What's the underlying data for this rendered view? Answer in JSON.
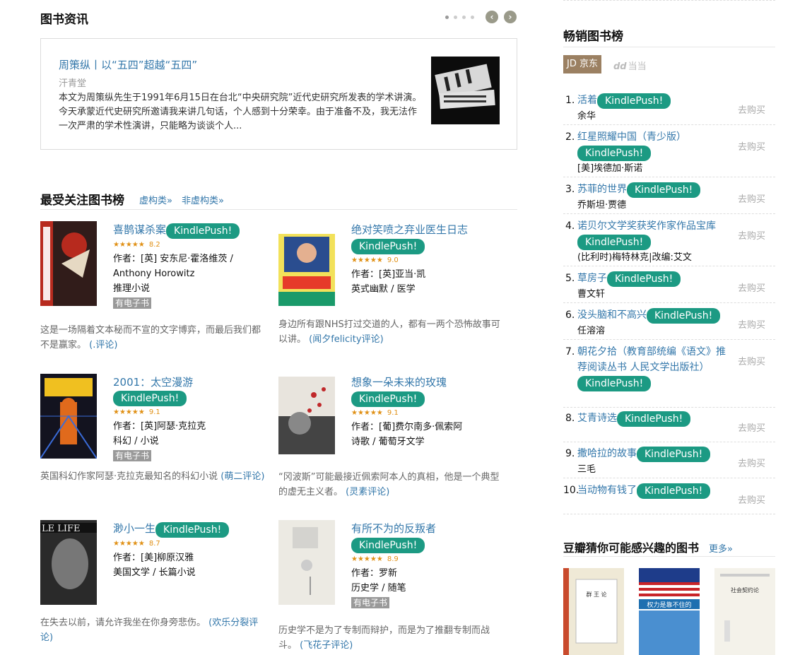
{
  "news": {
    "heading": "图书资讯",
    "prev": "‹",
    "next": "›",
    "item": {
      "title": "周策纵丨以“五四”超越“五四”",
      "author": "汗青堂",
      "desc": "本文为周策纵先生于1991年6月15日在台北“中央研究院”近代史研究所发表的学术讲演。今天承蒙近代史研究所邀请我来讲几句话，个人感到十分荣幸。由于准备不及，我无法作一次严肃的学术性演讲，只能略为谈谈个人..."
    }
  },
  "popular": {
    "heading": "最受关注图书榜",
    "tabs": [
      "虚构类»",
      "非虚构类»"
    ],
    "kindle": "KindlePush!",
    "ebook": "有电子书",
    "books": [
      {
        "title": "喜鹊谋杀案",
        "stars": "★★★★★",
        "score": "8.2",
        "lines": [
          "作者：[英] 安东尼·霍洛维茨 / Anthony Horowitz",
          "推理小说"
        ],
        "ebook": true,
        "desc": "这是一场隔着文本秘而不宣的文字博弈，而最后我们都不是赢家。",
        "review": "(.评论)",
        "cover_color": "#b72a1e"
      },
      {
        "title": "绝对笑喷之弃业医生日志",
        "stars": "★★★★★",
        "score": "9.0",
        "lines": [
          "作者：[英]亚当·凯",
          "英式幽默 / 医学"
        ],
        "ebook": false,
        "desc": "身边所有跟NHS打过交道的人，都有一两个恐怖故事可以讲。",
        "review": "(闻夕felicity评论)",
        "cover_color": "#f2e15a"
      },
      {
        "title": "2001：太空漫游",
        "stars": "★★★★★",
        "score": "9.1",
        "lines": [
          "作者：[英]阿瑟·克拉克",
          "科幻 / 小说"
        ],
        "ebook": true,
        "desc": "英国科幻作家阿瑟·克拉克最知名的科幻小说",
        "review": "(萌二评论)",
        "cover_color": "#13131f"
      },
      {
        "title": "想象一朵未来的玫瑰",
        "stars": "★★★★★",
        "score": "9.1",
        "lines": [
          "作者：[葡]费尔南多·佩索阿",
          "诗歌 / 葡萄牙文学"
        ],
        "ebook": false,
        "desc": "“冈波斯”可能最接近佩索阿本人的真相，他是一个典型的虚无主义者。",
        "review": "(灵素评论)",
        "cover_color": "#e8e4dd"
      },
      {
        "title": "渺小一生",
        "stars": "★★★★★",
        "score": "8.7",
        "lines": [
          "作者：[美]柳原汉雅",
          "美国文学 / 长篇小说"
        ],
        "ebook": false,
        "desc": "在失去以前，请允许我坐在你身旁悲伤。",
        "review": "(欢乐分裂评论)",
        "cover_color": "#2a2a2a"
      },
      {
        "title": "有所不为的反叛者",
        "stars": "★★★★★",
        "score": "8.9",
        "lines": [
          "作者：罗新",
          "历史学 / 随笔"
        ],
        "ebook": true,
        "desc": "历史学不是为了专制而辩护，而是为了推翻专制而战斗。",
        "review": "(飞花子评论)",
        "cover_color": "#eceae3"
      }
    ]
  },
  "bestsellers": {
    "heading": "畅销图书榜",
    "tab_jd": "JD 京东",
    "tab_dd": "当当",
    "tab_dd_logo": "dd",
    "buy": "去购买",
    "items": [
      {
        "no": "1.",
        "title": "活着",
        "author": "余华"
      },
      {
        "no": "2.",
        "title": "红星照耀中国（青少版）",
        "author": "[美]埃德加·斯诺"
      },
      {
        "no": "3.",
        "title": "苏菲的世界",
        "author": "乔斯坦·贾德"
      },
      {
        "no": "4.",
        "title": "诺贝尔文学奖获奖作家作品宝库",
        "author": "(比利时)梅特林克|改编:艾文"
      },
      {
        "no": "5.",
        "title": "草房子",
        "author": "曹文轩"
      },
      {
        "no": "6.",
        "title": "没头脑和不高兴",
        "author": "任溶溶"
      },
      {
        "no": "7.",
        "title": "朝花夕拾（教育部统编《语文》推荐阅读丛书 人民文学出版社）",
        "author": ""
      },
      {
        "no": "8.",
        "title": "艾青诗选",
        "author": ""
      },
      {
        "no": "9.",
        "title": "撒哈拉的故事",
        "author": "三毛"
      },
      {
        "no": "10.",
        "title": "当动物有钱了",
        "author": ""
      }
    ]
  },
  "guess": {
    "heading": "豆瓣猜你可能感兴趣的图书",
    "more": "更多»",
    "covers": [
      {
        "title": "群 王 论",
        "color": "#efe9d6"
      },
      {
        "title": "权力是靠不住的",
        "color": "#1e6fb0"
      },
      {
        "title": "社会契约论",
        "color": "#f4f2ea"
      }
    ]
  },
  "colors": {
    "link": "#3377aa",
    "kindle": "#1c9a83",
    "jd_tab": "#9b8062",
    "star": "#e09015"
  }
}
